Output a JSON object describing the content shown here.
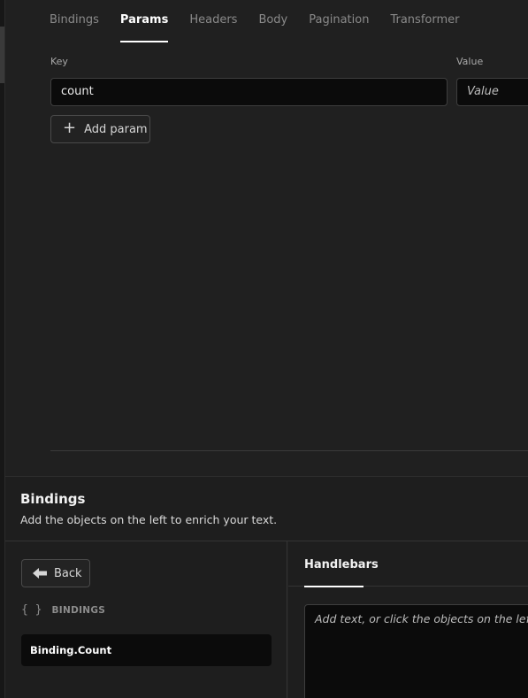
{
  "tabs": [
    {
      "label": "Bindings"
    },
    {
      "label": "Params"
    },
    {
      "label": "Headers"
    },
    {
      "label": "Body"
    },
    {
      "label": "Pagination"
    },
    {
      "label": "Transformer"
    }
  ],
  "active_tab": "Params",
  "params": {
    "key_label": "Key",
    "value_label": "Value",
    "rows": [
      {
        "key": "count",
        "value_placeholder": "Value"
      }
    ],
    "add_label": "Add param"
  },
  "bindings_panel": {
    "title": "Bindings",
    "subtitle": "Add the objects on the left to enrich your text.",
    "back_label": "Back",
    "braces": "{ }",
    "section_label": "BINDINGS",
    "items": [
      {
        "label": "Binding.Count"
      }
    ]
  },
  "editor": {
    "tab_label": "Handlebars",
    "placeholder": "Add text, or click the objects on the left to"
  },
  "icons": {
    "add": "plus-icon",
    "back": "arrow-left-icon",
    "section": "braces-icon"
  }
}
